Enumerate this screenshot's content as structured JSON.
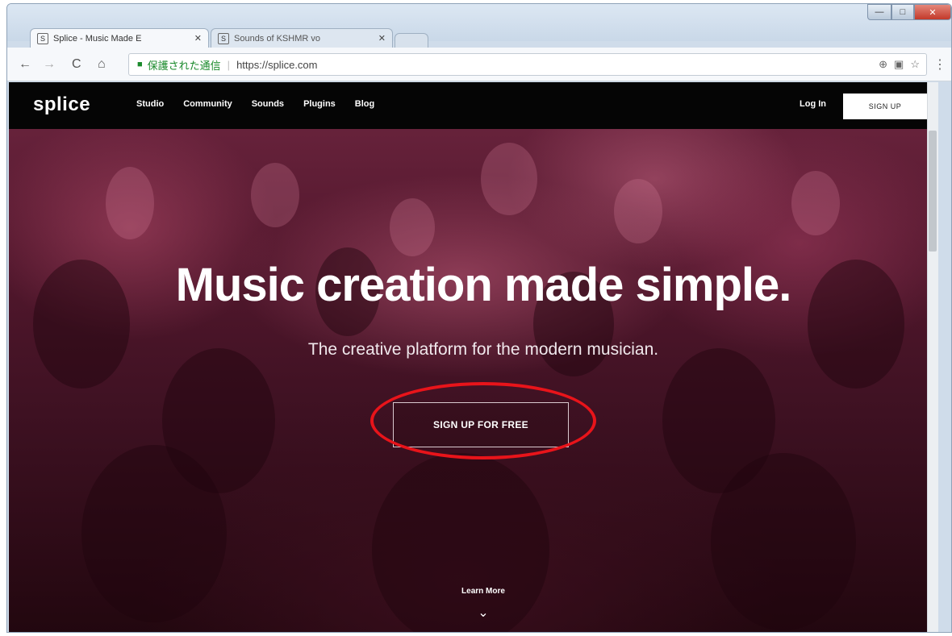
{
  "browser": {
    "tabs": [
      {
        "title": "Splice - Music Made E",
        "active": true
      },
      {
        "title": "Sounds of KSHMR vo",
        "active": false
      }
    ],
    "nav": {
      "back": "←",
      "forward": "→",
      "reload": "C",
      "home": "⌂"
    },
    "address": {
      "secure_label": "保護された通信",
      "url": "https://splice.com"
    },
    "window_controls": {
      "minimize": "—",
      "maximize": "□",
      "close": "✕"
    }
  },
  "site": {
    "logo": "splice",
    "nav_links": [
      "Studio",
      "Community",
      "Sounds",
      "Plugins",
      "Blog"
    ],
    "login": "Log In",
    "signup": "SIGN UP"
  },
  "hero": {
    "title": "Music creation made simple.",
    "subtitle": "The creative platform for the modern musician.",
    "cta": "SIGN UP FOR FREE",
    "learn_more": "Learn More"
  },
  "colors": {
    "highlight": "#e8141a",
    "hero_tint": "#6e2640",
    "nav_bg": "#050505"
  }
}
